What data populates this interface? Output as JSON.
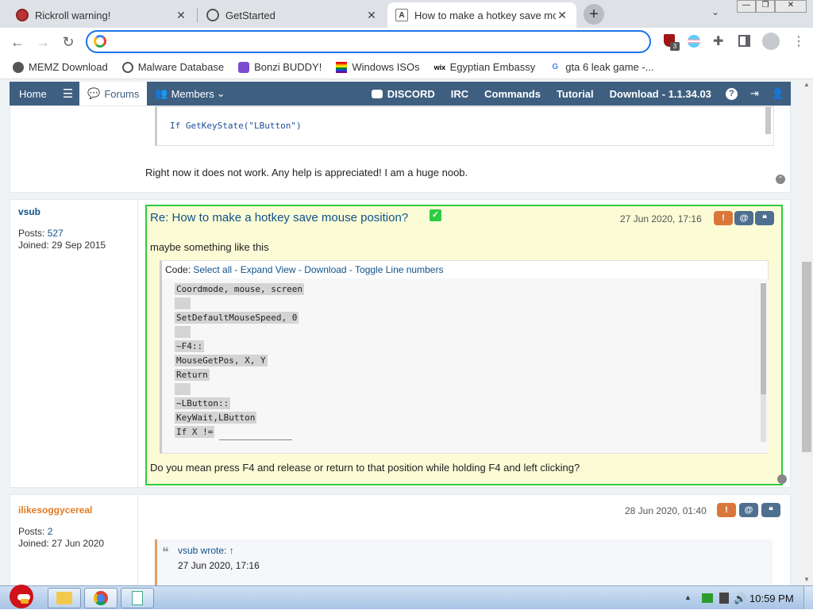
{
  "browser": {
    "tabs": [
      {
        "title": "Rickroll warning!",
        "icon": "rickroll-favicon"
      },
      {
        "title": "GetStarted",
        "icon": "globe-icon"
      },
      {
        "title": "How to make a hotkey save mouse position?",
        "icon": "autohotkey-favicon"
      }
    ],
    "address": "",
    "bookmarks": [
      "MEMZ Download",
      "Malware Database",
      "Bonzi BUDDY!",
      "Windows ISOs",
      "Egyptian Embassy",
      "gta 6 leak game -..."
    ],
    "extension_badge": "3"
  },
  "forum_nav": {
    "home": "Home",
    "forums": "Forums",
    "members": "Members",
    "discord": "DISCORD",
    "irc": "IRC",
    "commands": "Commands",
    "tutorial": "Tutorial",
    "download": "Download",
    "version": "- 1.1.34.03"
  },
  "post_prev": {
    "code_line": "If GetKeyState(\"LButton\")",
    "text": "Right now it does not work. Any help is appreciated! I am a huge noob."
  },
  "post_vsub": {
    "author": "vsub",
    "posts_label": "Posts:",
    "posts": "527",
    "joined_label": "Joined:",
    "joined": "29 Sep 2015",
    "title": "Re: How to make a hotkey save mouse position?",
    "date": "27 Jun 2020, 17:16",
    "intro": "maybe something like this",
    "code_label": "Code:",
    "code_links": "Select all - Expand View - Download - Toggle Line numbers",
    "code": [
      "Coordmode, mouse, screen",
      "",
      "SetDefaultMouseSpeed, 0",
      "",
      "~F4::",
      "MouseGetPos, X, Y",
      "Return",
      "",
      "~LButton::",
      "KeyWait,LButton",
      "If X !="
    ],
    "reply": "Do you mean press F4 and release or return to that position while holding F4 and left clicking?"
  },
  "post_ilike": {
    "author": "ilikesoggycereal",
    "posts_label": "Posts:",
    "posts": "2",
    "joined_label": "Joined:",
    "joined": "27 Jun 2020",
    "date": "28 Jun 2020, 01:40",
    "quote_author": "vsub wrote: ↑",
    "quote_date": "27 Jun 2020, 17:16"
  },
  "taskbar": {
    "clock": "10:59 PM"
  },
  "colors": {
    "nav": "#3e5f80",
    "highlight": "#2ecc40",
    "warn": "#d9773b",
    "mention": "#4e6f8f"
  }
}
